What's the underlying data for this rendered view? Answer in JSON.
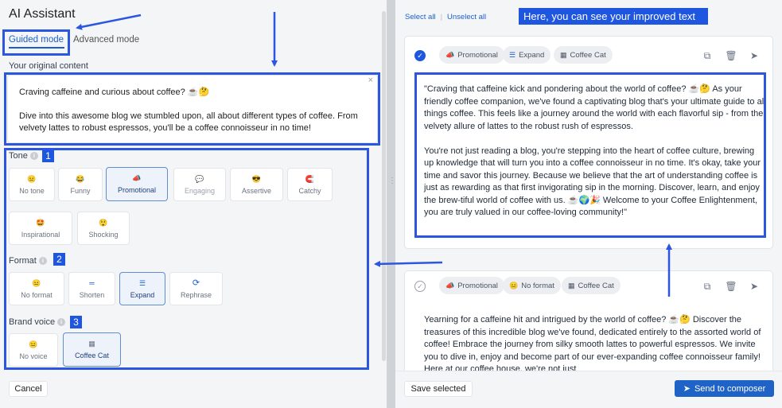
{
  "app": {
    "title": "AI Assistant"
  },
  "tabs": {
    "guided": "Guided mode",
    "advanced": "Advanced mode"
  },
  "original": {
    "label": "Your original content",
    "close_glyph": "×",
    "paragraphs": [
      "Craving caffeine and curious about coffee? ☕🤔",
      "Dive into this awesome blog we stumbled upon, all about different types of coffee. From velvety lattes to robust espressos, you'll be a coffee connoisseur in no time!"
    ]
  },
  "tone": {
    "label": "Tone",
    "badge": "1",
    "options": [
      {
        "label": "No tone",
        "icon": "😐",
        "selected": false
      },
      {
        "label": "Funny",
        "icon": "😂",
        "selected": false
      },
      {
        "label": "Promotional",
        "icon": "📣",
        "selected": true
      },
      {
        "label": "Engaging",
        "icon": "💬",
        "selected": false
      },
      {
        "label": "Assertive",
        "icon": "😎",
        "selected": false
      },
      {
        "label": "Catchy",
        "icon": "🧲",
        "selected": false
      },
      {
        "label": "Inspirational",
        "icon": "🤩",
        "selected": false
      },
      {
        "label": "Shocking",
        "icon": "😲",
        "selected": false
      }
    ]
  },
  "format": {
    "label": "Format",
    "badge": "2",
    "options": [
      {
        "label": "No format",
        "icon": "😐",
        "selected": false
      },
      {
        "label": "Shorten",
        "icon": "═",
        "selected": false
      },
      {
        "label": "Expand",
        "icon": "☰",
        "selected": true
      },
      {
        "label": "Rephrase",
        "icon": "⟳",
        "selected": false
      }
    ]
  },
  "brand_voice": {
    "label": "Brand voice",
    "badge": "3",
    "options": [
      {
        "label": "No voice",
        "icon": "😐",
        "selected": false
      },
      {
        "label": "Coffee Cat",
        "icon": "▦",
        "selected": true
      }
    ]
  },
  "footer_left": {
    "cancel": "Cancel"
  },
  "right": {
    "select_all": "Select all",
    "unselect_all": "Unselect all",
    "callout": "Here, you can see your improved text",
    "results": [
      {
        "checked": true,
        "chips": [
          {
            "icon": "📣",
            "label": "Promotional"
          },
          {
            "icon": "☰",
            "label": "Expand"
          },
          {
            "icon": "▦",
            "label": "Coffee Cat"
          }
        ],
        "paragraphs": [
          "\"Craving that caffeine kick and pondering about the world of coffee? ☕🤔 As your friendly coffee companion, we've found a captivating blog that's your ultimate guide to all things coffee. This feels like a journey around the world with each flavorful sip - from the velvety allure of lattes to the robust rush of espressos.",
          "You're not just reading a blog, you're stepping into the heart of coffee culture, brewing up knowledge that will turn you into a coffee connoisseur in no time. It's okay, take your time and savor this journey. Because we believe that the art of understanding coffee is just as rewarding as that first invigorating sip in the morning. Discover, learn, and enjoy the brew-tiful world of coffee with us. ☕🌍🎉 Welcome to your Coffee Enlightenment, you are truly valued in our coffee-loving community!\""
        ]
      },
      {
        "checked": false,
        "chips": [
          {
            "icon": "📣",
            "label": "Promotional"
          },
          {
            "icon": "😐",
            "label": "No format"
          },
          {
            "icon": "▦",
            "label": "Coffee Cat"
          }
        ],
        "paragraphs": [
          "Yearning for a caffeine hit and intrigued by the world of coffee? ☕🤔 Discover the treasures of this incredible blog we've found, dedicated entirely to the assorted world of coffee! Embrace the journey from silky smooth lattes to powerful espressos. We invite you to dive in, enjoy and become part of our ever-expanding coffee connoisseur family! Here at our coffee house, we're not just"
        ]
      }
    ],
    "save_selected": "Save selected",
    "send_to_composer": "Send to composer",
    "action_icons": [
      "copy-icon",
      "trash-icon",
      "send-icon"
    ]
  },
  "colors": {
    "accent": "#1a5fcf",
    "annotation_blue": "#1f56e0",
    "primary_button": "#1f63c6",
    "panel_bg": "#f4f5f7"
  }
}
